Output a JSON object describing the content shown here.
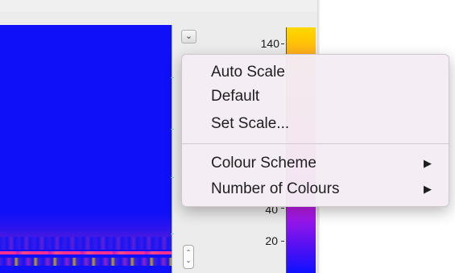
{
  "toolbar": {
    "dropdown_icon": "chevron-down-icon",
    "dropdown_glyph": "⌄"
  },
  "colorbar": {
    "ticks": [
      {
        "label": "140",
        "value": 140
      },
      {
        "label": "40",
        "value": 40
      },
      {
        "label": "20",
        "value": 20
      }
    ],
    "colors": {
      "top": "#ffd800",
      "middle": "#ff3a8a",
      "bottom": "#1010ff"
    }
  },
  "spectrogram": {
    "background": "#1010f8",
    "highlight": "#ff2f8f"
  },
  "stepper": {
    "up": "⌃",
    "down": "⌄"
  },
  "menu": {
    "items": [
      {
        "label": "Auto Scale",
        "submenu": false
      },
      {
        "label": "Default",
        "submenu": false
      },
      {
        "label": "Set Scale...",
        "submenu": false
      },
      {
        "label": "Colour Scheme",
        "submenu": true
      },
      {
        "label": "Number of Colours",
        "submenu": true
      }
    ],
    "submenu_arrow": "▶"
  }
}
